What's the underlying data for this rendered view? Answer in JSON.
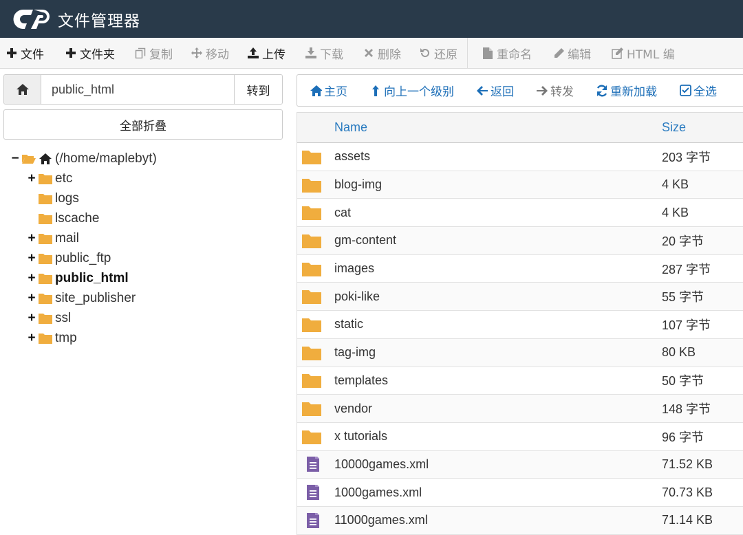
{
  "header": {
    "app_title": "文件管理器",
    "brand_color": "#293a4a"
  },
  "toolbar": {
    "items": [
      {
        "label": "文件",
        "icon": "plus-icon",
        "enabled": true
      },
      {
        "label": "文件夹",
        "icon": "plus-icon",
        "enabled": true
      },
      {
        "label": "复制",
        "icon": "copy-icon",
        "enabled": false
      },
      {
        "label": "移动",
        "icon": "move-icon",
        "enabled": false
      },
      {
        "label": "上传",
        "icon": "upload-icon",
        "enabled": true
      },
      {
        "label": "下载",
        "icon": "download-icon",
        "enabled": false
      },
      {
        "label": "删除",
        "icon": "delete-icon",
        "enabled": false
      },
      {
        "label": "还原",
        "icon": "restore-icon",
        "enabled": false
      },
      {
        "label": "重命名",
        "icon": "file-icon",
        "enabled": false
      },
      {
        "label": "编辑",
        "icon": "pencil-icon",
        "enabled": false
      },
      {
        "label": "HTML 编",
        "icon": "html-edit-icon",
        "enabled": false
      }
    ]
  },
  "path_bar": {
    "value": "public_html",
    "go_label": "转到"
  },
  "collapse_all_label": "全部折叠",
  "tree": {
    "root": {
      "label": "(/home/maplebyt)"
    },
    "children": [
      {
        "label": "etc",
        "expandable": true,
        "bold": false
      },
      {
        "label": "logs",
        "expandable": false,
        "bold": false
      },
      {
        "label": "lscache",
        "expandable": false,
        "bold": false
      },
      {
        "label": "mail",
        "expandable": true,
        "bold": false
      },
      {
        "label": "public_ftp",
        "expandable": true,
        "bold": false
      },
      {
        "label": "public_html",
        "expandable": true,
        "bold": true
      },
      {
        "label": "site_publisher",
        "expandable": true,
        "bold": false
      },
      {
        "label": "ssl",
        "expandable": true,
        "bold": false
      },
      {
        "label": "tmp",
        "expandable": true,
        "bold": false
      }
    ]
  },
  "nav": {
    "items": [
      {
        "label": "主页",
        "icon": "home-icon",
        "enabled": true
      },
      {
        "label": "向上一个级别",
        "icon": "level-up-icon",
        "enabled": true
      },
      {
        "label": "返回",
        "icon": "arrow-left-icon",
        "enabled": true
      },
      {
        "label": "转发",
        "icon": "arrow-right-icon",
        "enabled": false
      },
      {
        "label": "重新加载",
        "icon": "refresh-icon",
        "enabled": true
      },
      {
        "label": "全选",
        "icon": "checkbox-icon",
        "enabled": true
      }
    ]
  },
  "table": {
    "headers": {
      "name": "Name",
      "size": "Size"
    },
    "rows": [
      {
        "name": "assets",
        "size": "203 字节",
        "type": "folder"
      },
      {
        "name": "blog-img",
        "size": "4 KB",
        "type": "folder"
      },
      {
        "name": "cat",
        "size": "4 KB",
        "type": "folder"
      },
      {
        "name": "gm-content",
        "size": "20 字节",
        "type": "folder"
      },
      {
        "name": "images",
        "size": "287 字节",
        "type": "folder"
      },
      {
        "name": "poki-like",
        "size": "55 字节",
        "type": "folder"
      },
      {
        "name": "static",
        "size": "107 字节",
        "type": "folder"
      },
      {
        "name": "tag-img",
        "size": "80 KB",
        "type": "folder"
      },
      {
        "name": "templates",
        "size": "50 字节",
        "type": "folder"
      },
      {
        "name": "vendor",
        "size": "148 字节",
        "type": "folder"
      },
      {
        "name": "x tutorials",
        "size": "96 字节",
        "type": "folder"
      },
      {
        "name": "10000games.xml",
        "size": "71.52 KB",
        "type": "file"
      },
      {
        "name": "1000games.xml",
        "size": "70.73 KB",
        "type": "file"
      },
      {
        "name": "11000games.xml",
        "size": "71.14 KB",
        "type": "file"
      }
    ]
  },
  "colors": {
    "folder": "#f0ad3e",
    "file": "#7b5ea7",
    "link": "#1d6fb8",
    "header_text": "#2a7bc0"
  }
}
